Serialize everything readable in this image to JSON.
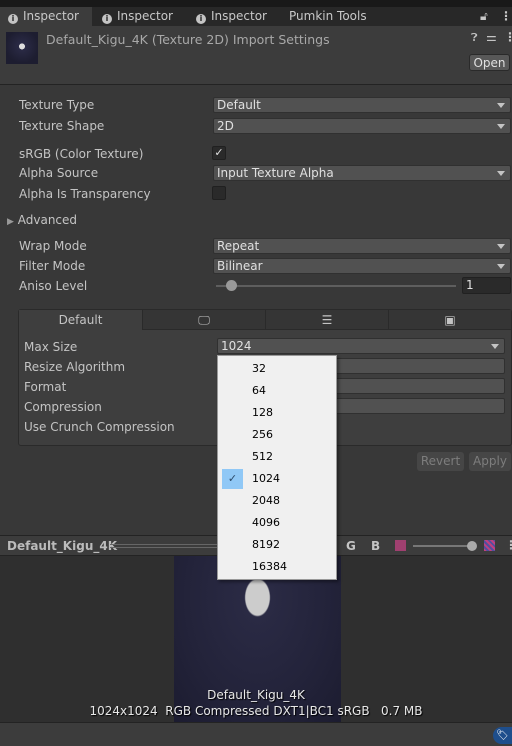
{
  "tabs": [
    {
      "label": "Inspector",
      "icon": "info-icon"
    },
    {
      "label": "Inspector",
      "icon": "info-icon"
    },
    {
      "label": "Inspector",
      "icon": "info-icon"
    },
    {
      "label": "Pumkin Tools"
    }
  ],
  "header": {
    "title": "Default_Kigu_4K (Texture 2D) Import Settings",
    "open_label": "Open"
  },
  "settings": {
    "texture_type": {
      "label": "Texture Type",
      "value": "Default"
    },
    "texture_shape": {
      "label": "Texture Shape",
      "value": "2D"
    },
    "srgb": {
      "label": "sRGB (Color Texture)",
      "checked": true
    },
    "alpha_source": {
      "label": "Alpha Source",
      "value": "Input Texture Alpha"
    },
    "alpha_transparency": {
      "label": "Alpha Is Transparency",
      "checked": false
    },
    "advanced": {
      "label": "Advanced"
    },
    "wrap_mode": {
      "label": "Wrap Mode",
      "value": "Repeat"
    },
    "filter_mode": {
      "label": "Filter Mode",
      "value": "Bilinear"
    },
    "aniso": {
      "label": "Aniso Level",
      "value": "1"
    }
  },
  "platform": {
    "tabs": [
      {
        "label": "Default"
      },
      {
        "icon": "monitor-icon"
      },
      {
        "icon": "server-icon"
      },
      {
        "icon": "android-icon"
      }
    ],
    "max_size": {
      "label": "Max Size",
      "value": "1024"
    },
    "resize": {
      "label": "Resize Algorithm"
    },
    "format": {
      "label": "Format"
    },
    "compression": {
      "label": "Compression"
    },
    "crunch": {
      "label": "Use Crunch Compression"
    }
  },
  "buttons": {
    "revert": "Revert",
    "apply": "Apply"
  },
  "menu": {
    "options": [
      "32",
      "64",
      "128",
      "256",
      "512",
      "1024",
      "2048",
      "4096",
      "8192",
      "16384"
    ],
    "selected": "1024"
  },
  "preview": {
    "title": "Default_Kigu_4K",
    "g": "G",
    "b": "B",
    "name": "Default_Kigu_4K",
    "info": "1024x1024  RGB Compressed DXT1|BC1 sRGB   0.7 MB"
  },
  "colors": {
    "accent": "#90c8f6",
    "tag": "#1e4e8c"
  }
}
